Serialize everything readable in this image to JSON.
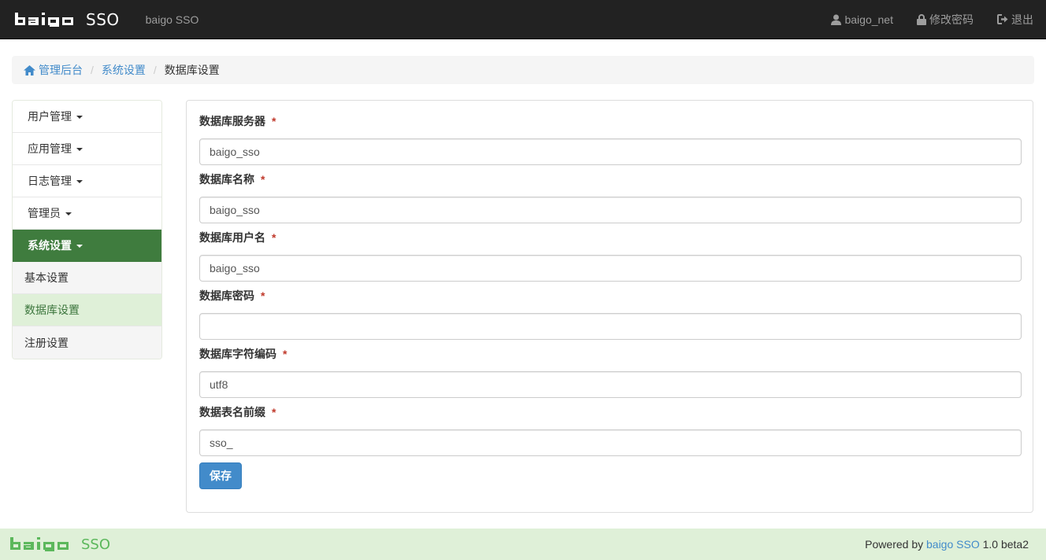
{
  "navbar": {
    "brand_logo": "baigo",
    "brand_sso": "SSO",
    "title": "baigo SSO",
    "user_label": "baigo_net",
    "change_password_label": "修改密码",
    "logout_label": "退出",
    "icons": {
      "user": "user-icon",
      "lock": "lock-icon",
      "logout": "logout-icon"
    }
  },
  "breadcrumb": {
    "home_label": "管理后台",
    "section_label": "系统设置",
    "current_label": "数据库设置",
    "separator": "/"
  },
  "sidebar": {
    "items": [
      {
        "label": "用户管理"
      },
      {
        "label": "应用管理"
      },
      {
        "label": "日志管理"
      },
      {
        "label": "管理员"
      },
      {
        "label": "系统设置"
      }
    ],
    "sub_items": [
      {
        "label": "基本设置"
      },
      {
        "label": "数据库设置"
      },
      {
        "label": "注册设置"
      }
    ],
    "active_color": "#3f7c3e",
    "current_sub_color": "#dff0d8"
  },
  "form": {
    "required_mark": "*",
    "fields": [
      {
        "label": "数据库服务器",
        "value": "baigo_sso"
      },
      {
        "label": "数据库名称",
        "value": "baigo_sso"
      },
      {
        "label": "数据库用户名",
        "value": "baigo_sso"
      },
      {
        "label": "数据库密码",
        "value": ""
      },
      {
        "label": "数据库字符编码",
        "value": "utf8"
      },
      {
        "label": "数据表名前缀",
        "value": "sso_"
      }
    ],
    "save_label": "保存",
    "primary_color": "#428bca"
  },
  "footer": {
    "brand_logo": "baigo",
    "brand_sso": "SSO",
    "powered_by": "Powered by",
    "product_link": "baigo SSO",
    "version": "1.0 beta2",
    "brand_color": "#5cb85c"
  }
}
